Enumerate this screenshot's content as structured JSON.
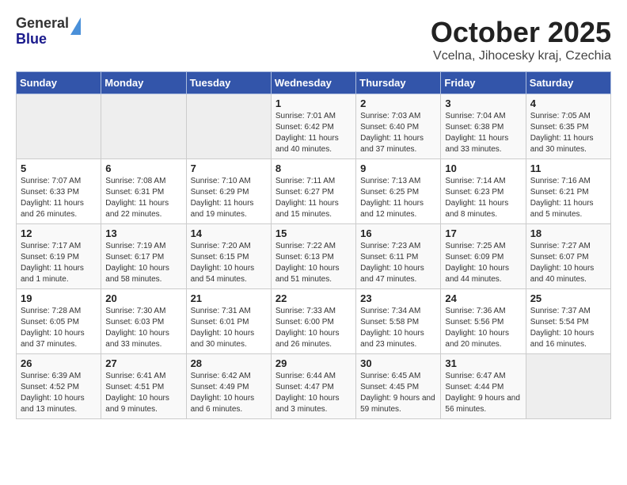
{
  "header": {
    "logo_line1": "General",
    "logo_line2": "Blue",
    "month": "October 2025",
    "location": "Vcelna, Jihocesky kraj, Czechia"
  },
  "days_of_week": [
    "Sunday",
    "Monday",
    "Tuesday",
    "Wednesday",
    "Thursday",
    "Friday",
    "Saturday"
  ],
  "weeks": [
    [
      {
        "day": null
      },
      {
        "day": null
      },
      {
        "day": null
      },
      {
        "day": "1",
        "sunrise": "7:01 AM",
        "sunset": "6:42 PM",
        "daylight": "11 hours and 40 minutes."
      },
      {
        "day": "2",
        "sunrise": "7:03 AM",
        "sunset": "6:40 PM",
        "daylight": "11 hours and 37 minutes."
      },
      {
        "day": "3",
        "sunrise": "7:04 AM",
        "sunset": "6:38 PM",
        "daylight": "11 hours and 33 minutes."
      },
      {
        "day": "4",
        "sunrise": "7:05 AM",
        "sunset": "6:35 PM",
        "daylight": "11 hours and 30 minutes."
      }
    ],
    [
      {
        "day": "5",
        "sunrise": "7:07 AM",
        "sunset": "6:33 PM",
        "daylight": "11 hours and 26 minutes."
      },
      {
        "day": "6",
        "sunrise": "7:08 AM",
        "sunset": "6:31 PM",
        "daylight": "11 hours and 22 minutes."
      },
      {
        "day": "7",
        "sunrise": "7:10 AM",
        "sunset": "6:29 PM",
        "daylight": "11 hours and 19 minutes."
      },
      {
        "day": "8",
        "sunrise": "7:11 AM",
        "sunset": "6:27 PM",
        "daylight": "11 hours and 15 minutes."
      },
      {
        "day": "9",
        "sunrise": "7:13 AM",
        "sunset": "6:25 PM",
        "daylight": "11 hours and 12 minutes."
      },
      {
        "day": "10",
        "sunrise": "7:14 AM",
        "sunset": "6:23 PM",
        "daylight": "11 hours and 8 minutes."
      },
      {
        "day": "11",
        "sunrise": "7:16 AM",
        "sunset": "6:21 PM",
        "daylight": "11 hours and 5 minutes."
      }
    ],
    [
      {
        "day": "12",
        "sunrise": "7:17 AM",
        "sunset": "6:19 PM",
        "daylight": "11 hours and 1 minute."
      },
      {
        "day": "13",
        "sunrise": "7:19 AM",
        "sunset": "6:17 PM",
        "daylight": "10 hours and 58 minutes."
      },
      {
        "day": "14",
        "sunrise": "7:20 AM",
        "sunset": "6:15 PM",
        "daylight": "10 hours and 54 minutes."
      },
      {
        "day": "15",
        "sunrise": "7:22 AM",
        "sunset": "6:13 PM",
        "daylight": "10 hours and 51 minutes."
      },
      {
        "day": "16",
        "sunrise": "7:23 AM",
        "sunset": "6:11 PM",
        "daylight": "10 hours and 47 minutes."
      },
      {
        "day": "17",
        "sunrise": "7:25 AM",
        "sunset": "6:09 PM",
        "daylight": "10 hours and 44 minutes."
      },
      {
        "day": "18",
        "sunrise": "7:27 AM",
        "sunset": "6:07 PM",
        "daylight": "10 hours and 40 minutes."
      }
    ],
    [
      {
        "day": "19",
        "sunrise": "7:28 AM",
        "sunset": "6:05 PM",
        "daylight": "10 hours and 37 minutes."
      },
      {
        "day": "20",
        "sunrise": "7:30 AM",
        "sunset": "6:03 PM",
        "daylight": "10 hours and 33 minutes."
      },
      {
        "day": "21",
        "sunrise": "7:31 AM",
        "sunset": "6:01 PM",
        "daylight": "10 hours and 30 minutes."
      },
      {
        "day": "22",
        "sunrise": "7:33 AM",
        "sunset": "6:00 PM",
        "daylight": "10 hours and 26 minutes."
      },
      {
        "day": "23",
        "sunrise": "7:34 AM",
        "sunset": "5:58 PM",
        "daylight": "10 hours and 23 minutes."
      },
      {
        "day": "24",
        "sunrise": "7:36 AM",
        "sunset": "5:56 PM",
        "daylight": "10 hours and 20 minutes."
      },
      {
        "day": "25",
        "sunrise": "7:37 AM",
        "sunset": "5:54 PM",
        "daylight": "10 hours and 16 minutes."
      }
    ],
    [
      {
        "day": "26",
        "sunrise": "6:39 AM",
        "sunset": "4:52 PM",
        "daylight": "10 hours and 13 minutes."
      },
      {
        "day": "27",
        "sunrise": "6:41 AM",
        "sunset": "4:51 PM",
        "daylight": "10 hours and 9 minutes."
      },
      {
        "day": "28",
        "sunrise": "6:42 AM",
        "sunset": "4:49 PM",
        "daylight": "10 hours and 6 minutes."
      },
      {
        "day": "29",
        "sunrise": "6:44 AM",
        "sunset": "4:47 PM",
        "daylight": "10 hours and 3 minutes."
      },
      {
        "day": "30",
        "sunrise": "6:45 AM",
        "sunset": "4:45 PM",
        "daylight": "9 hours and 59 minutes."
      },
      {
        "day": "31",
        "sunrise": "6:47 AM",
        "sunset": "4:44 PM",
        "daylight": "9 hours and 56 minutes."
      },
      {
        "day": null
      }
    ]
  ]
}
